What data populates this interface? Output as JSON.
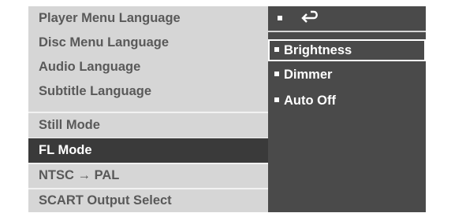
{
  "menu": {
    "items": [
      {
        "label": "Player Menu Language"
      },
      {
        "label": "Disc Menu Language"
      },
      {
        "label": "Audio Language"
      },
      {
        "label": "Subtitle Language"
      },
      {
        "label": "Still Mode"
      },
      {
        "label": "FL Mode",
        "selected": true
      },
      {
        "label": "NTSC → PAL"
      },
      {
        "label": "SCART Output Select"
      }
    ]
  },
  "submenu": {
    "header_icon": "return-arrow-icon",
    "items": [
      {
        "label": "Brightness",
        "highlighted": true
      },
      {
        "label": "Dimmer"
      },
      {
        "label": "Auto Off"
      }
    ]
  },
  "colors": {
    "panel_bg": "#d6d6d6",
    "item_text": "#595959",
    "selected_bg": "#3a3a3a",
    "submenu_bg": "#4a4a4a",
    "highlight_text": "#ffffff"
  }
}
